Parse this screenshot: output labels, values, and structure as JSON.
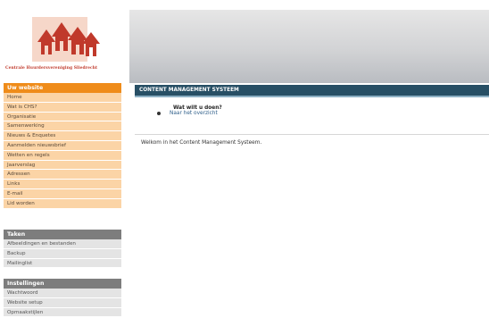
{
  "logo": {
    "text": "Centrale Huurdersvereniging Sliedrecht",
    "icon": "houses-logo-icon",
    "color": "#c0392b"
  },
  "menus": {
    "site": {
      "header": "Uw website",
      "items": [
        "Home",
        "Wat is CHS?",
        "Organisatie",
        "Samenwerking",
        "Nieuws & Enquetes",
        "Aanmelden nieuwsbrief",
        "Wetten en regels",
        "Jaarverslag",
        "Adressen",
        "Links",
        "E-mail",
        "Lid worden"
      ]
    },
    "taken": {
      "header": "Taken",
      "items": [
        "Afbeeldingen en bestanden",
        "Backup",
        "Mailinglist"
      ]
    },
    "instellingen": {
      "header": "Instellingen",
      "items": [
        "Wachtwoord",
        "Website setup",
        "Opmaakstijlen"
      ]
    }
  },
  "main": {
    "title": "CONTENT MANAGEMENT SYSTEEM",
    "question": "Wat wilt u doen?",
    "link": "Naar het overzicht",
    "welcome": "Welkom in het Content Management Systeem."
  },
  "colors": {
    "accent": "#ef8c1a",
    "title_bar": "#274f65",
    "menu_gray": "#7d7d7d"
  }
}
